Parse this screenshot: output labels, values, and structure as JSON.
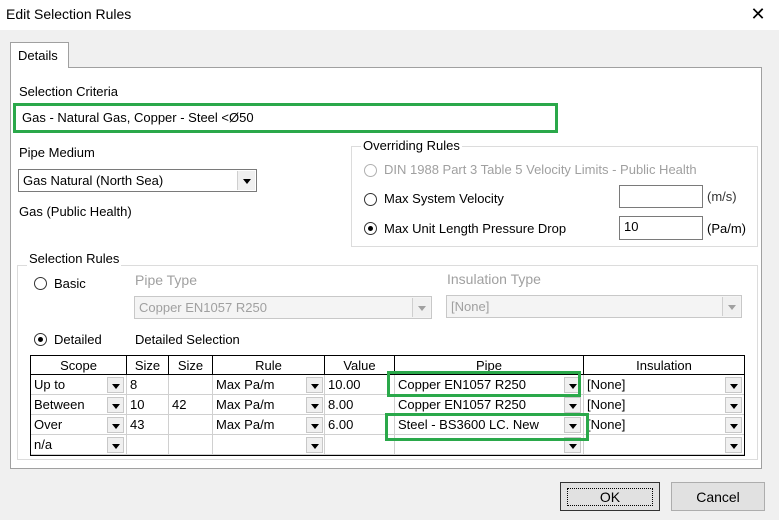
{
  "window": {
    "title": "Edit Selection Rules"
  },
  "tabs": [
    {
      "label": "Details"
    }
  ],
  "selection_criteria": {
    "label": "Selection Criteria",
    "value": "Gas - Natural Gas, Copper - Steel <Ø50"
  },
  "pipe_medium": {
    "label": "Pipe Medium",
    "value": "Gas Natural (North Sea)",
    "category": "Gas (Public Health)"
  },
  "overriding_rules": {
    "title": "Overriding Rules",
    "options": [
      {
        "label": "DIN 1988 Part 3 Table 5 Velocity Limits - Public Health",
        "state": "disabled"
      },
      {
        "label": "Max System Velocity",
        "value": "",
        "unit": "(m/s)"
      },
      {
        "label": "Max Unit Length Pressure Drop",
        "value": "10",
        "unit": "(Pa/m)",
        "selected": true
      }
    ]
  },
  "selection_rules": {
    "title": "Selection Rules",
    "basic": {
      "label": "Basic"
    },
    "pipe_type": {
      "label": "Pipe Type",
      "value": "Copper EN1057 R250"
    },
    "insulation_type": {
      "label": "Insulation Type",
      "value": "[None]"
    },
    "detailed": {
      "label": "Detailed",
      "selected": true
    },
    "detailed_selection_label": "Detailed Selection",
    "grid": {
      "headers": [
        "Scope",
        "Size",
        "Size",
        "Rule",
        "Value",
        "Pipe",
        "Insulation"
      ],
      "rows": [
        {
          "scope": "Up to",
          "size1": "8",
          "size2": "",
          "rule": "Max Pa/m",
          "value": "10.00",
          "pipe": "Copper EN1057 R250",
          "insulation": "[None]"
        },
        {
          "scope": "Between",
          "size1": "10",
          "size2": "42",
          "rule": "Max Pa/m",
          "value": "8.00",
          "pipe": "Copper EN1057 R250",
          "insulation": "[None]"
        },
        {
          "scope": "Over",
          "size1": "43",
          "size2": "",
          "rule": "Max Pa/m",
          "value": "6.00",
          "pipe": "Steel - BS3600 LC. New",
          "insulation": "[None]"
        },
        {
          "scope": "n/a",
          "size1": "",
          "size2": "",
          "rule": "",
          "value": "",
          "pipe": "",
          "insulation": ""
        }
      ]
    }
  },
  "buttons": {
    "ok": "OK",
    "cancel": "Cancel"
  },
  "colors": {
    "highlight": "#2aa84a"
  }
}
